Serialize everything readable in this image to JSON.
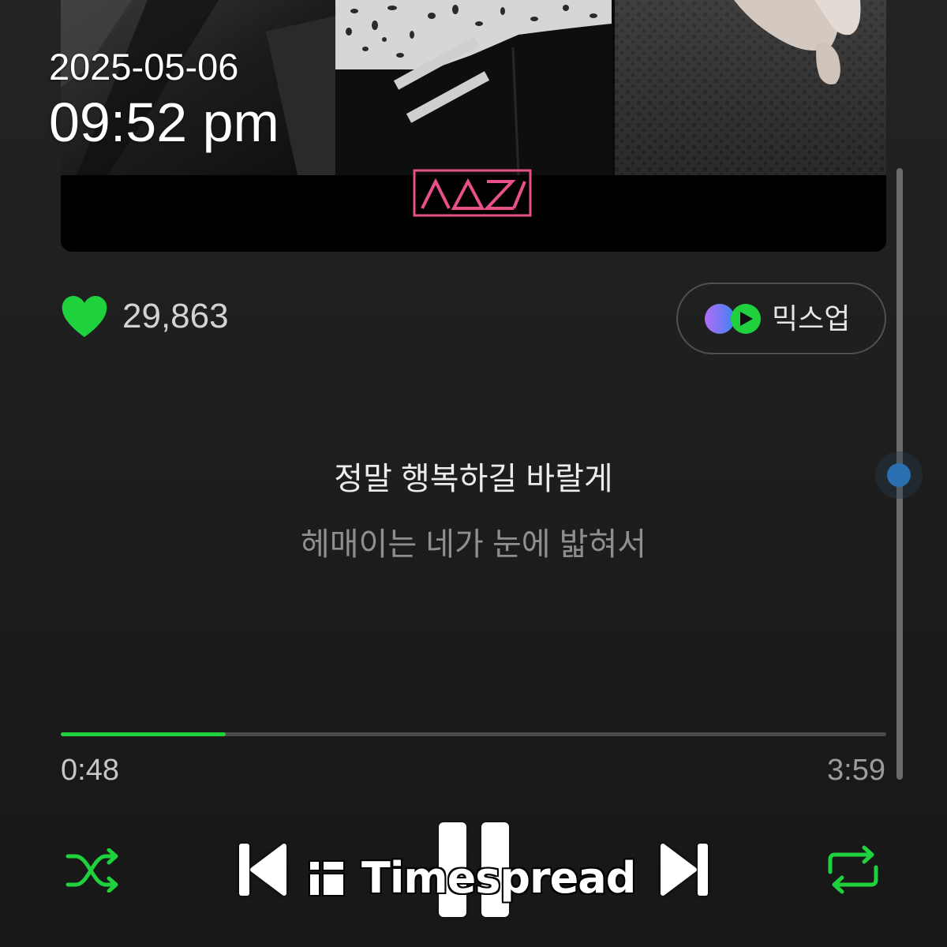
{
  "status_overlay": {
    "date": "2025-05-06",
    "time": "09:52 pm"
  },
  "album_art": {
    "logo_icon": "artist-logo",
    "logo_color": "#e8508a"
  },
  "like": {
    "icon": "heart-icon",
    "count": "29,863"
  },
  "mixup": {
    "icon": "mixup-icon",
    "label": "믹스업"
  },
  "lyrics": {
    "current_line": "정말 행복하길 바랄게",
    "next_line": "헤매이는 네가 눈에 밟혀서"
  },
  "progress": {
    "elapsed": "0:48",
    "duration": "3:59",
    "fraction": 0.2
  },
  "controls": {
    "shuffle_icon": "shuffle-icon",
    "previous_icon": "skip-previous-icon",
    "pause_icon": "pause-icon",
    "next_icon": "skip-next-icon",
    "repeat_icon": "repeat-icon"
  },
  "watermark": {
    "icon": "timespread-logo-icon",
    "text": "Timespread"
  },
  "colors": {
    "accent": "#1fd13d",
    "background": "#1e1e1e",
    "scroll_thumb": "#2a6fb0",
    "logo": "#e8508a"
  }
}
